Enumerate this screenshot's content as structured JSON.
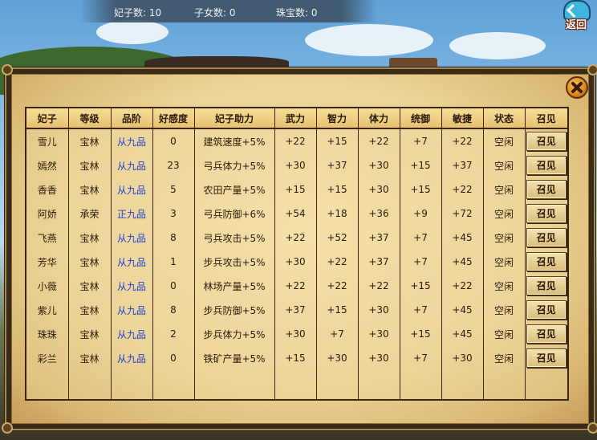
{
  "topbar": {
    "consorts_label": "妃子数: 10",
    "children_label": "子女数: 0",
    "jewels_label": "珠宝数: 0"
  },
  "back_button": {
    "label": "返回"
  },
  "table": {
    "headers": [
      "妃子",
      "等级",
      "品阶",
      "好感度",
      "妃子助力",
      "武力",
      "智力",
      "体力",
      "统御",
      "敏捷",
      "状态",
      "召见"
    ],
    "rows": [
      {
        "name": "雪儿",
        "level": "宝林",
        "rank": "从九品",
        "favor": "0",
        "bonus": "建筑速度+5%",
        "force": "+22",
        "intellect": "+15",
        "stamina": "+22",
        "command": "+7",
        "agility": "+22",
        "status": "空闲",
        "action": "召见"
      },
      {
        "name": "嫣然",
        "level": "宝林",
        "rank": "从九品",
        "favor": "23",
        "bonus": "弓兵体力+5%",
        "force": "+30",
        "intellect": "+37",
        "stamina": "+30",
        "command": "+15",
        "agility": "+37",
        "status": "空闲",
        "action": "召见"
      },
      {
        "name": "香香",
        "level": "宝林",
        "rank": "从九品",
        "favor": "5",
        "bonus": "农田产量+5%",
        "force": "+15",
        "intellect": "+15",
        "stamina": "+30",
        "command": "+15",
        "agility": "+22",
        "status": "空闲",
        "action": "召见"
      },
      {
        "name": "阿娇",
        "level": "承荣",
        "rank": "正九品",
        "favor": "3",
        "bonus": "弓兵防御+6%",
        "force": "+54",
        "intellect": "+18",
        "stamina": "+36",
        "command": "+9",
        "agility": "+72",
        "status": "空闲",
        "action": "召见"
      },
      {
        "name": "飞燕",
        "level": "宝林",
        "rank": "从九品",
        "favor": "8",
        "bonus": "弓兵攻击+5%",
        "force": "+22",
        "intellect": "+52",
        "stamina": "+37",
        "command": "+7",
        "agility": "+45",
        "status": "空闲",
        "action": "召见"
      },
      {
        "name": "芳华",
        "level": "宝林",
        "rank": "从九品",
        "favor": "1",
        "bonus": "步兵攻击+5%",
        "force": "+30",
        "intellect": "+22",
        "stamina": "+37",
        "command": "+7",
        "agility": "+45",
        "status": "空闲",
        "action": "召见"
      },
      {
        "name": "小薇",
        "level": "宝林",
        "rank": "从九品",
        "favor": "0",
        "bonus": "林场产量+5%",
        "force": "+22",
        "intellect": "+22",
        "stamina": "+22",
        "command": "+15",
        "agility": "+22",
        "status": "空闲",
        "action": "召见"
      },
      {
        "name": "紫儿",
        "level": "宝林",
        "rank": "从九品",
        "favor": "8",
        "bonus": "步兵防御+5%",
        "force": "+37",
        "intellect": "+15",
        "stamina": "+30",
        "command": "+7",
        "agility": "+45",
        "status": "空闲",
        "action": "召见"
      },
      {
        "name": "珠珠",
        "level": "宝林",
        "rank": "从九品",
        "favor": "2",
        "bonus": "步兵体力+5%",
        "force": "+30",
        "intellect": "+7",
        "stamina": "+30",
        "command": "+15",
        "agility": "+45",
        "status": "空闲",
        "action": "召见"
      },
      {
        "name": "彩兰",
        "level": "宝林",
        "rank": "从九品",
        "favor": "0",
        "bonus": "铁矿产量+5%",
        "force": "+15",
        "intellect": "+30",
        "stamina": "+30",
        "command": "+7",
        "agility": "+30",
        "status": "空闲",
        "action": "召见"
      }
    ]
  },
  "colors": {
    "rank_text": "#1a3fd6",
    "border": "#3d2610",
    "parchment": "#ecd397"
  }
}
